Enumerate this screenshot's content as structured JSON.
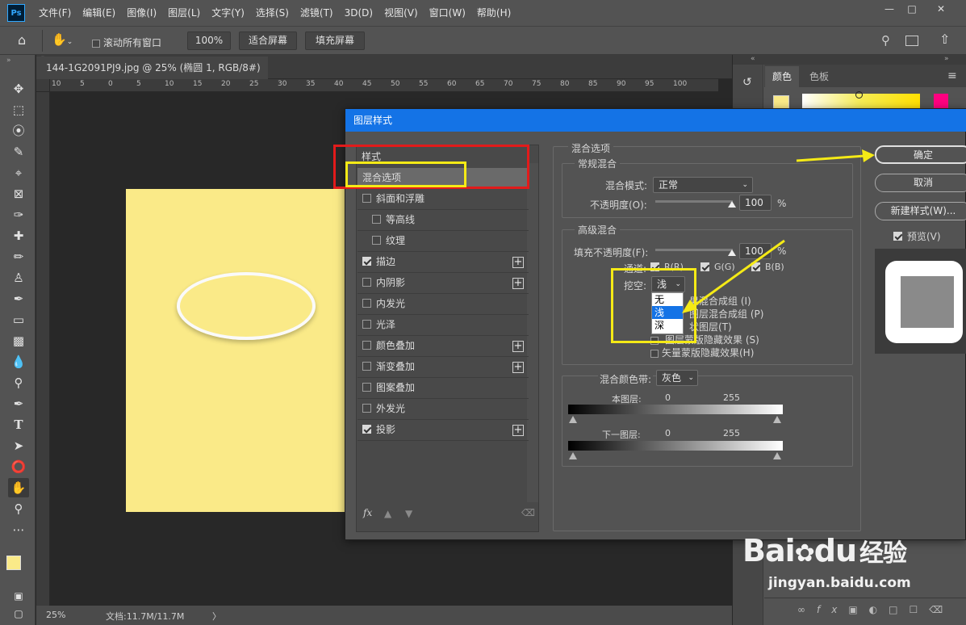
{
  "menubar": {
    "logo": "Ps",
    "items": [
      "文件(F)",
      "编辑(E)",
      "图像(I)",
      "图层(L)",
      "文字(Y)",
      "选择(S)",
      "滤镜(T)",
      "3D(D)",
      "视图(V)",
      "窗口(W)",
      "帮助(H)"
    ]
  },
  "optionsbar": {
    "scroll_all": "滚动所有窗口",
    "zoom_100": "100%",
    "fit_screen": "适合屏幕",
    "fill_screen": "填充屏幕"
  },
  "document": {
    "tab_title": "144-1G2091PJ9.jpg @ 25% (椭圆 1, RGB/8#) *",
    "ruler_labels": [
      "10",
      "5",
      "0",
      "5",
      "10",
      "15",
      "20",
      "25",
      "30",
      "35",
      "40",
      "45",
      "50",
      "55",
      "60",
      "65",
      "70",
      "75",
      "80",
      "85",
      "90",
      "95",
      "100"
    ],
    "doc_color": "#faea88"
  },
  "statusbar": {
    "zoom": "25%",
    "doc_info": "文档:11.7M/11.7M",
    "arrow": "〉"
  },
  "right_panel": {
    "tab_color": "颜色",
    "tab_swatches": "色板"
  },
  "dialog": {
    "title": "图层样式",
    "styles_header": "样式",
    "styles": [
      {
        "label": "混合选项",
        "checkbox": false,
        "checked": false,
        "plus": false,
        "selected": true
      },
      {
        "label": "斜面和浮雕",
        "checkbox": true,
        "checked": false,
        "plus": false
      },
      {
        "label": "等高线",
        "checkbox": true,
        "checked": false,
        "plus": false,
        "indent": true
      },
      {
        "label": "纹理",
        "checkbox": true,
        "checked": false,
        "plus": false,
        "indent": true
      },
      {
        "label": "描边",
        "checkbox": true,
        "checked": true,
        "plus": true
      },
      {
        "label": "内阴影",
        "checkbox": true,
        "checked": false,
        "plus": true
      },
      {
        "label": "内发光",
        "checkbox": true,
        "checked": false,
        "plus": false
      },
      {
        "label": "光泽",
        "checkbox": true,
        "checked": false,
        "plus": false
      },
      {
        "label": "颜色叠加",
        "checkbox": true,
        "checked": false,
        "plus": true
      },
      {
        "label": "渐变叠加",
        "checkbox": true,
        "checked": false,
        "plus": true
      },
      {
        "label": "图案叠加",
        "checkbox": true,
        "checked": false,
        "plus": false
      },
      {
        "label": "外发光",
        "checkbox": true,
        "checked": false,
        "plus": false
      },
      {
        "label": "投影",
        "checkbox": true,
        "checked": true,
        "plus": true
      }
    ],
    "footer_fx": "fx",
    "blend": {
      "section": "混合选项",
      "general": "常规混合",
      "mode_label": "混合模式:",
      "mode_value": "正常",
      "opacity_label": "不透明度(O):",
      "opacity_value": "100",
      "pct": "%",
      "advanced": "高级混合",
      "fill_label": "填充不透明度(F):",
      "fill_value": "100",
      "channels_label": "通道:",
      "ch_r": "R(R)",
      "ch_g": "G(G)",
      "ch_b": "B(B)",
      "knockout_label": "挖空:",
      "knockout_value": "浅",
      "knockout_options": [
        "无",
        "浅",
        "深"
      ],
      "opt1_tail": "果混合成组 (I)",
      "opt2_tail": "图层混合成组 (P)",
      "opt3_tail": "状图层(T)",
      "opt4_tail": "图层蒙版隐藏效果 (S)",
      "opt5": "矢量蒙版隐藏效果(H)",
      "blend_if_label": "混合颜色带:",
      "blend_if_value": "灰色",
      "this_layer": "本图层:",
      "this_min": "0",
      "this_max": "255",
      "under_layer": "下一图层:",
      "under_min": "0",
      "under_max": "255"
    },
    "buttons": {
      "ok": "确定",
      "cancel": "取消",
      "new_style": "新建样式(W)...",
      "preview": "预览(V)"
    }
  },
  "watermark": {
    "brand": "Bai",
    "brand2": "du",
    "cn": "经验",
    "url": "jingyan.baidu.com"
  },
  "colors": {
    "accent_blue": "#1473e6",
    "highlight_red": "#e21b1b",
    "highlight_yellow": "#f5ea16"
  }
}
